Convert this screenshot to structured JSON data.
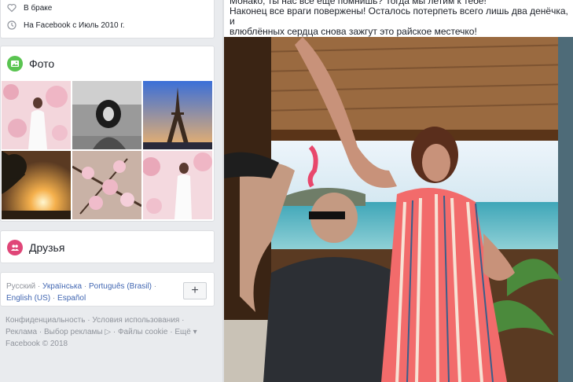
{
  "intro": {
    "marital_status": "В браке",
    "joined": "На Facebook с Июль 2010 г."
  },
  "photos": {
    "title": "Фото",
    "icon": "photo-icon",
    "accent": "#5ac451"
  },
  "friends": {
    "title": "Друзья",
    "icon": "friends-icon",
    "accent": "#e04678"
  },
  "languages": {
    "current": "Русский",
    "items": [
      "Українська",
      "Português (Brasil)",
      "English (US)",
      "Español"
    ],
    "add_label": "+"
  },
  "footer": {
    "links": [
      "Конфиденциальность",
      "Условия использования",
      "Реклама",
      "Выбор рекламы",
      "Файлы cookie",
      "Ещё"
    ],
    "copyright": "Facebook © 2018"
  },
  "post": {
    "line1": "Монако, ты нас всё ещё помнишь? Тогда мы летим к тебе!",
    "line2": "Наконец все враги повержены! Осталось потерпеть всего лишь два денёчка, и",
    "line3": "влюблённых сердца снова зажгут это райское местечко!"
  }
}
